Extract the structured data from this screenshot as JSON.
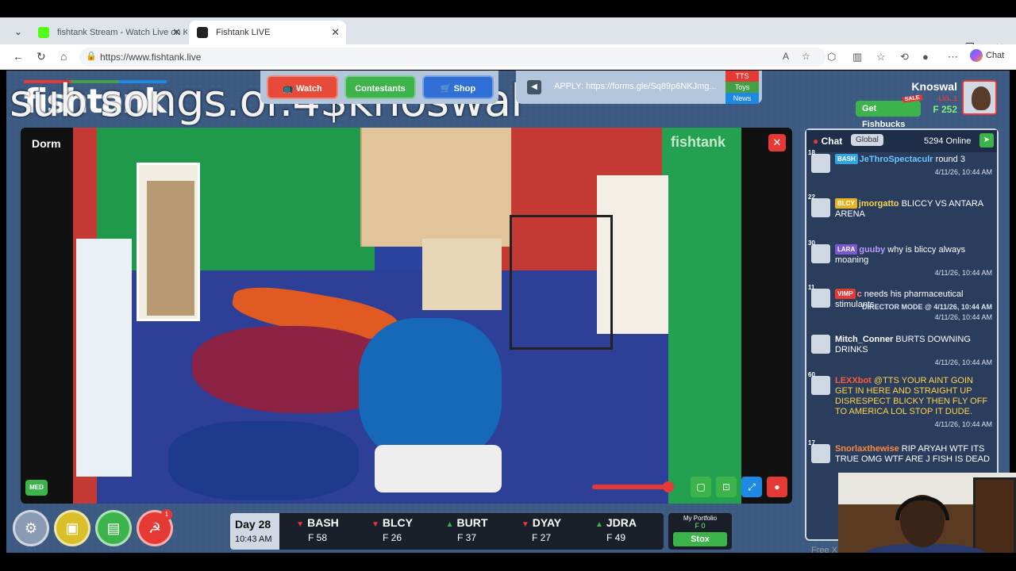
{
  "browser": {
    "tabs": [
      {
        "title": "fishtank Stream - Watch Live on K",
        "active": false
      },
      {
        "title": "Fishtank LIVE",
        "active": true
      }
    ],
    "url": "https://www.fishtank.live",
    "chat_label": "Chat"
  },
  "page": {
    "logo": "fishtank",
    "overlay_text": "sub songs.or.4$knoswal",
    "nav": {
      "watch": "Watch",
      "contestants": "Contestants",
      "shop": "Shop"
    },
    "apply_text": "APPLY: https://forms.gle/Sq89p6NKJmg...",
    "side_tabs": [
      "TTS",
      "Toys",
      "News"
    ],
    "user": {
      "name": "Knoswal",
      "level": "LVL 1",
      "fishbucks": "F 252",
      "get_fishbucks": "Get Fishbucks",
      "sale": "SALE"
    }
  },
  "video": {
    "room": "Dorm",
    "quality": "MED",
    "watermark": "fishtank",
    "volume_fraction": 0.92
  },
  "chat": {
    "title": "Chat",
    "scope": "Global",
    "online": "5294 Online",
    "input_placeholder": "Free X",
    "messages": [
      {
        "level": "18",
        "badge": "BASH",
        "badge_color": "#2fa7e0",
        "user": "JeThroSpectaculr",
        "user_color": "#6bc3ff",
        "text": "round 3",
        "ts": "4/11/26, 10:44 AM"
      },
      {
        "level": "22",
        "badge": "BLCY",
        "badge_color": "#e6b422",
        "user": "jmorgatto",
        "user_color": "#f3d35a",
        "text": "BLICCY VS ANTARA ARENA",
        "ts": ""
      },
      {
        "level": "30",
        "badge": "LARA",
        "badge_color": "#7b57d1",
        "user": "guuby",
        "user_color": "#b59bff",
        "text": "why is bliccy always moaning",
        "ts": "4/11/26, 10:44 AM"
      },
      {
        "level": "11",
        "badge": "VIMP",
        "badge_color": "#e53935",
        "user": "c",
        "user_color": "#ff8a8a",
        "text": "needs his pharmaceutical stimulants",
        "ts": "4/11/26, 10:44 AM"
      },
      {
        "level": "",
        "badge": "",
        "badge_color": "",
        "user": "Mitch_Conner",
        "user_color": "#ffffff",
        "text": "BURTS DOWNING DRINKS",
        "ts": "4/11/26, 10:44 AM"
      },
      {
        "level": "60",
        "badge": "",
        "badge_color": "",
        "user": "LEXXbot",
        "user_color": "#ff5a3c",
        "text": "@TTS YOUR AINT GOIN GET IN HERE AND STRAIGHT UP DISRESPECT BLICKY THEN FLY OFF TO AMERICA LOL STOP IT DUDE.",
        "ts": "4/11/26, 10:44 AM"
      },
      {
        "level": "17",
        "badge": "",
        "badge_color": "",
        "user": "Snorlaxthewise",
        "user_color": "#ff8a3c",
        "text": "RIP ARYAH WTF ITS TRUE OMG WTF ARE J FISH IS DEAD",
        "ts": ""
      }
    ],
    "director": "DIRECTOR MODE @ 4/11/26, 10:44 AM"
  },
  "bottom": {
    "day": "Day 28",
    "time": "10:43 AM",
    "stocks": [
      {
        "ticker": "BASH",
        "dir": "down",
        "price": "F 58"
      },
      {
        "ticker": "BLCY",
        "dir": "down",
        "price": "F 26"
      },
      {
        "ticker": "BURT",
        "dir": "up",
        "price": "F 37"
      },
      {
        "ticker": "DYAY",
        "dir": "down",
        "price": "F 27"
      },
      {
        "ticker": "JDRA",
        "dir": "up",
        "price": "F 49"
      }
    ],
    "portfolio_label": "My Portfolio",
    "portfolio_value": "F 0",
    "stox": "Stox",
    "notif_count": "1"
  },
  "colors": {
    "page_bg": "#3d5a82",
    "red": "#e53935",
    "green": "#3cb44b",
    "blue": "#1e88e5"
  }
}
